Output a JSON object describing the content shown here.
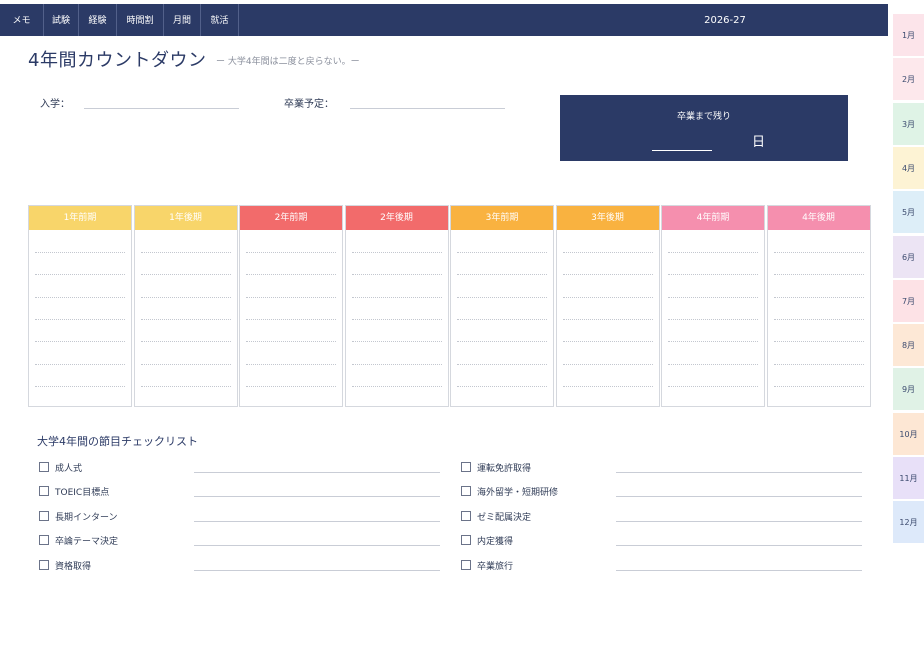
{
  "nav": {
    "tabs": [
      "メモ",
      "試験",
      "経験",
      "時間割",
      "月間",
      "就活"
    ],
    "year": "2026-27"
  },
  "months": [
    "1月",
    "2月",
    "3月",
    "4月",
    "5月",
    "6月",
    "7月",
    "8月",
    "9月",
    "10月",
    "11月",
    "12月"
  ],
  "month_colors": [
    "#fce4ea",
    "#fde8ec",
    "#dff3e6",
    "#fdf3d4",
    "#ddeef8",
    "#ece4f4",
    "#fde2e6",
    "#fde8d6",
    "#e0f2e6",
    "#fde7d4",
    "#e8e0f8",
    "#dde9fa"
  ],
  "header": {
    "title": "4年間カウントダウン",
    "subtitle": "ー 大学4年間は二度と戻らない。ー",
    "enroll_label": "入学：",
    "graduate_label": "卒業予定："
  },
  "countdown": {
    "label": "卒業まで残り",
    "unit": "日"
  },
  "semesters": [
    {
      "label": "1年前期",
      "color": "#f8d56a"
    },
    {
      "label": "1年後期",
      "color": "#f8d56a"
    },
    {
      "label": "2年前期",
      "color": "#f26b6b"
    },
    {
      "label": "2年後期",
      "color": "#f26b6b"
    },
    {
      "label": "3年前期",
      "color": "#f9b240"
    },
    {
      "label": "3年後期",
      "color": "#f9b240"
    },
    {
      "label": "4年前期",
      "color": "#f58fae"
    },
    {
      "label": "4年後期",
      "color": "#f58fae"
    }
  ],
  "checklist": {
    "title": "大学4年間の節目チェックリスト",
    "left": [
      "成人式",
      "TOEIC目標点",
      "長期インターン",
      "卒論テーマ決定",
      "資格取得"
    ],
    "right": [
      "運転免許取得",
      "海外留学・短期研修",
      "ゼミ配属決定",
      "内定獲得",
      "卒業旅行"
    ]
  }
}
